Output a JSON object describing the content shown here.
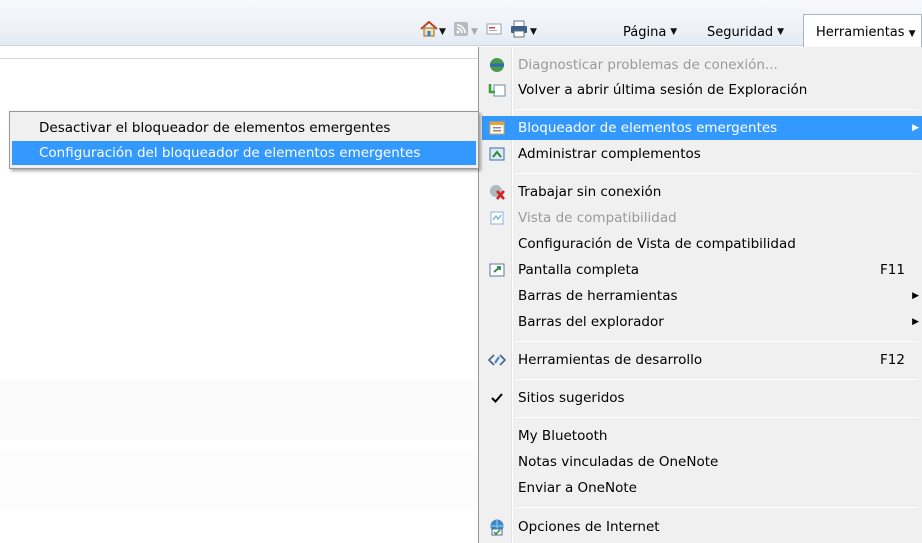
{
  "commandbar": {
    "home_caret": "▼",
    "feeds_caret": "▼",
    "print_caret": "▼",
    "page_label": "Página",
    "safety_label": "Seguridad",
    "tools_label": "Herramientas",
    "caret": "▼"
  },
  "menu": {
    "items": [
      {
        "label": "Diagnosticar problemas de conexión...",
        "icon": "network-diagnose-icon",
        "disabled": true
      },
      {
        "label": "Volver a abrir última sesión de Exploración",
        "icon": "reopen-session-icon"
      },
      {
        "label": "Bloqueador de elementos emergentes",
        "icon": "popup-blocker-icon",
        "submenu": true,
        "active": true
      },
      {
        "label": "Administrar complementos",
        "icon": "addons-icon"
      },
      {
        "label": "Trabajar sin conexión",
        "icon": "offline-icon"
      },
      {
        "label": "Vista de compatibilidad",
        "icon": "compatibility-view-icon",
        "disabled": true
      },
      {
        "label": "Configuración de Vista de compatibilidad"
      },
      {
        "label": "Pantalla completa",
        "icon": "fullscreen-icon",
        "shortcut": "F11"
      },
      {
        "label": "Barras de herramientas",
        "submenu": true
      },
      {
        "label": "Barras del explorador",
        "submenu": true
      },
      {
        "label": "Herramientas de desarrollo",
        "icon": "developer-tools-icon",
        "shortcut": "F12"
      },
      {
        "label": "Sitios sugeridos",
        "icon": "check-icon",
        "checked": true
      },
      {
        "label": "My Bluetooth"
      },
      {
        "label": "Notas vinculadas de OneNote"
      },
      {
        "label": "Enviar a OneNote"
      },
      {
        "label": "Opciones de Internet",
        "icon": "internet-options-icon"
      }
    ],
    "submenu_arrow": "▶"
  },
  "submenu": {
    "items": [
      {
        "label": "Desactivar el bloqueador de elementos emergentes"
      },
      {
        "label": "Configuración del bloqueador de elementos emergentes",
        "active": true
      }
    ]
  },
  "colors": {
    "highlight": "#3399ff",
    "menu_bg": "#f0f0f0"
  }
}
